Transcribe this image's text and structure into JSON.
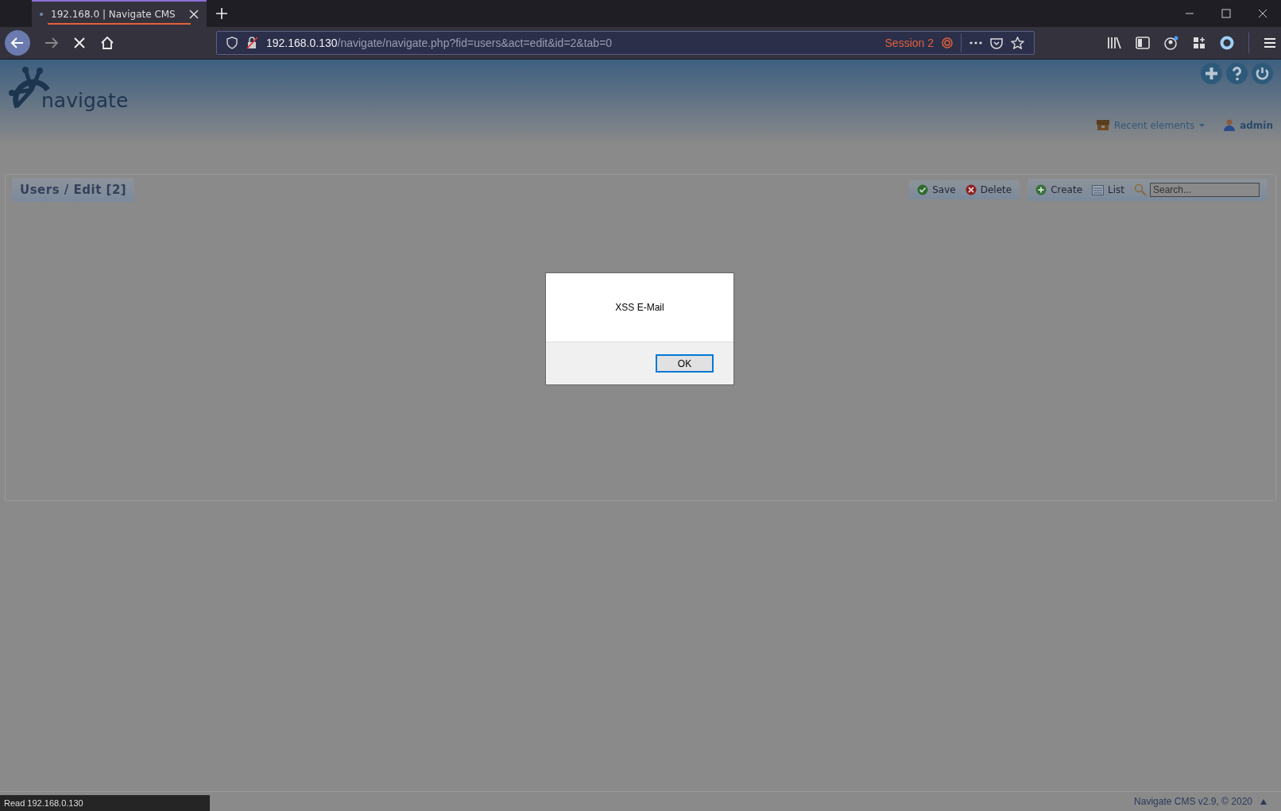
{
  "browser": {
    "tabs": [
      {
        "title": "192.168.0 | Navigate CMS",
        "selected": true
      }
    ],
    "url": {
      "host": "192.168.0.130",
      "path": "/navigate/navigate.php?fid=users&act=edit&id=2&tab=0"
    },
    "container": "Session 2"
  },
  "header": {
    "logo": "navigate",
    "recent": "Recent elements",
    "user": "admin"
  },
  "panel": {
    "title": "Users / Edit [2]",
    "actions": [
      {
        "label": "Save",
        "kind": "save"
      },
      {
        "label": "Delete",
        "kind": "delete"
      }
    ],
    "tools": [
      {
        "label": "Create",
        "kind": "create"
      },
      {
        "label": "List",
        "kind": "list"
      }
    ],
    "search": {
      "placeholder": "Search..."
    }
  },
  "footer": "Navigate CMS v2.9, © 2020",
  "dialog": {
    "message": "XSS E-Mail",
    "button": "OK"
  },
  "status_bar": "Read 192.168.0.130"
}
